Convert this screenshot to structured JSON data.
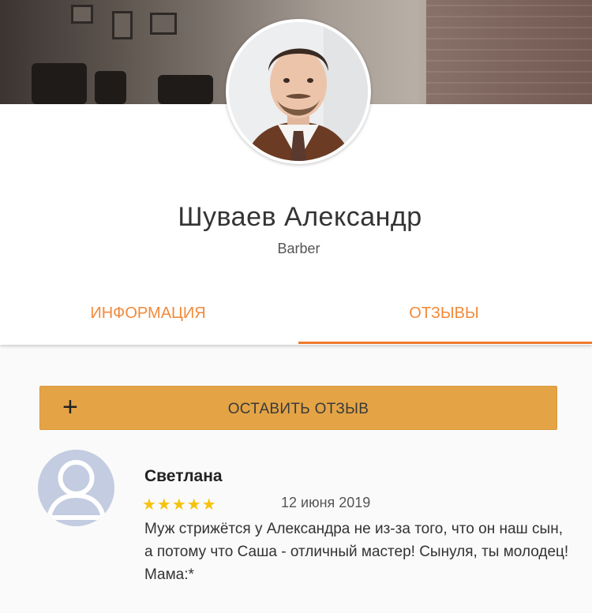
{
  "profile": {
    "name": "Шуваев Александр",
    "role": "Barber"
  },
  "tabs": [
    {
      "label": "ИНФОРМАЦИЯ",
      "active": false
    },
    {
      "label": "ОТЗЫВЫ",
      "active": true
    }
  ],
  "actions": {
    "add_review_label": "ОСТАВИТЬ ОТЗЫВ",
    "add_icon": "plus-icon"
  },
  "review": {
    "author": "Светлана",
    "rating": 5,
    "stars_text": "★★★★★",
    "date": "12 июня 2019",
    "text": "Муж стрижётся у Александра не из-за того, что он наш сын, а потому что Саша - отличный мастер! Сынуля, ты молодец! Мама:*"
  },
  "colors": {
    "accent": "#ee7a2b",
    "button": "#e4a446",
    "star": "#f6c20b"
  }
}
